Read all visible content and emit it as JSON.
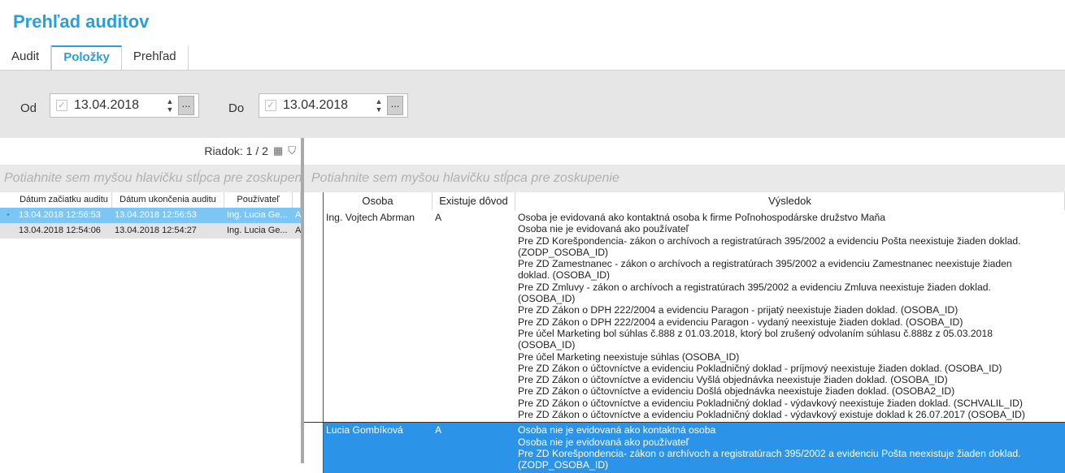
{
  "app": {
    "title": "Prehľad auditov"
  },
  "tabs": [
    {
      "label": "Audit"
    },
    {
      "label": "Položky"
    },
    {
      "label": "Prehľad"
    }
  ],
  "filter": {
    "from_label": "Od",
    "from_value": "13.04.2018",
    "to_label": "Do",
    "to_value": "13.04.2018",
    "dots": "..."
  },
  "left_panel": {
    "row_info": "Riadok: 1 / 2",
    "group_hint": "Potiahnite sem myšou hlavičku stĺpca pre zoskupenie",
    "columns": [
      "Dátum začiatku auditu",
      "Dátum ukončenia auditu",
      "Používateľ"
    ],
    "rows": [
      {
        "start": "13.04.2018 12:56:53",
        "end": "13.04.2018 12:56:53",
        "user": "Ing. Lucia Ge...",
        "extra": "A"
      },
      {
        "start": "13.04.2018 12:54:06",
        "end": "13.04.2018 12:54:27",
        "user": "Ing. Lucia Ge...",
        "extra": "A"
      }
    ]
  },
  "right_panel": {
    "group_hint": "Potiahnite sem myšou hlavičku stĺpca pre zoskupenie",
    "columns": [
      "Osoba",
      "Existuje dôvod",
      "Výsledok"
    ],
    "rows": [
      {
        "osoba": "Ing. Vojtech Abrman",
        "dovod": "A",
        "lines": [
          "Osoba je evidovaná ako kontaktná osoba k firme Poľnohospodárske družstvo Maňa",
          "Osoba nie je evidovaná ako používateľ",
          "Pre ZD Korešpondencia- zákon o archívoch a registratúrach 395/2002 a evidenciu Pošta neexistuje žiaden doklad.",
          "(ZODP_OSOBA_ID)",
          "Pre ZD Zamestnanec - zákon o archívoch a registratúrach 395/2002 a evidenciu Zamestnanec neexistuje žiaden",
          "doklad. (OSOBA_ID)",
          "Pre ZD Zmluvy - zákon o archívoch a registratúrach 395/2002 a evidenciu Zmluva neexistuje žiaden doklad.",
          "(OSOBA_ID)",
          "Pre ZD Zákon o DPH 222/2004 a evidenciu Paragon - prijatý neexistuje žiaden doklad. (OSOBA_ID)",
          "Pre ZD Zákon o DPH 222/2004 a evidenciu Paragon - vydaný neexistuje žiaden doklad. (OSOBA_ID)",
          "Pre účel Marketing bol súhlas č.888 z 01.03.2018, ktorý bol zrušený odvolaním súhlasu č.888z z 05.03.2018",
          "(OSOBA_ID)",
          "Pre účel Marketing neexistuje súhlas (OSOBA_ID)",
          "Pre ZD Zákon o účtovníctve a evidenciu Pokladničný doklad - príjmový neexistuje žiaden doklad. (OSOBA_ID)",
          "Pre ZD Zákon o účtovníctve a evidenciu Vyšlá objednávka neexistuje žiaden doklad. (OSOBA_ID)",
          "Pre ZD Zákon o účtovníctve a evidenciu Došlá objednávka neexistuje žiaden doklad. (OSOBA2_ID)",
          "Pre ZD Zákon o účtovníctve a evidenciu Pokladničný doklad - výdavkový neexistuje žiaden doklad. (SCHVALIL_ID)",
          "Pre ZD Zákon o účtovníctve a evidenciu Pokladničný doklad - výdavkový existuje doklad k 26.07.2017 (OSOBA_ID)"
        ]
      },
      {
        "osoba": "Lucia Gombíková",
        "dovod": "A",
        "lines": [
          "Osoba nie je evidovaná ako kontaktná osoba",
          "Osoba nie je evidovaná ako používateľ",
          "Pre ZD Korešpondencia- zákon o archívoch a registratúrach 395/2002 a evidenciu Pošta neexistuje žiaden doklad.",
          "(ZODP_OSOBA_ID)"
        ]
      }
    ]
  }
}
